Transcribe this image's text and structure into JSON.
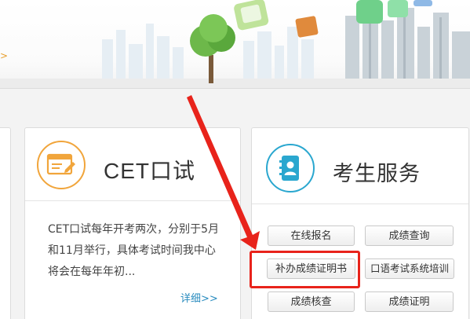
{
  "banner": {
    "nav_arrow": ">"
  },
  "cet_panel": {
    "title": "CET口试",
    "icon": "certificate-icon",
    "description": "CET口试每年开考两次，分别于5月和11月举行，具体考试时间我中心将会在每年年初...",
    "more_link": "详细>>"
  },
  "service_panel": {
    "title": "考生服务",
    "icon": "address-book-icon",
    "buttons": {
      "online_registration": "在线报名",
      "score_query": "成绩查询",
      "makeup_certificate": "补办成绩证明书",
      "oral_training": "口语考试系统培训",
      "score_verification": "成绩核查",
      "score_certificate": "成绩证明"
    }
  },
  "annotation": {
    "color": "#e8231b",
    "target": "补办成绩证明书"
  },
  "colors": {
    "cet_accent": "#f1a53b",
    "service_accent": "#2aa7cf",
    "link": "#2a8cbf"
  }
}
